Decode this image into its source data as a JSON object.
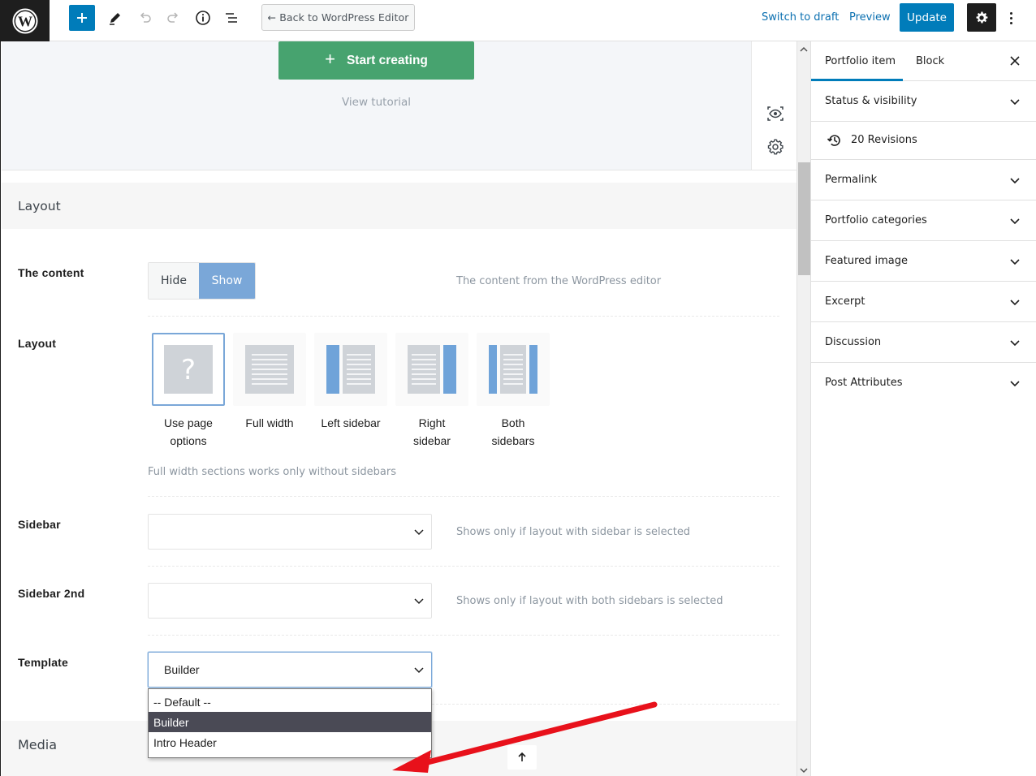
{
  "toolbar": {
    "back_label": "← Back to WordPress Editor",
    "switch_draft": "Switch to draft",
    "preview": "Preview",
    "update": "Update"
  },
  "builder": {
    "start_label": "Start creating",
    "tutorial_label": "View tutorial"
  },
  "layout_section": {
    "heading": "Layout",
    "content": {
      "label": "The content",
      "options": [
        "Hide",
        "Show"
      ],
      "selected": "Show",
      "hint": "The content from the WordPress editor"
    },
    "layout": {
      "label": "Layout",
      "options": [
        {
          "line1": "Use page",
          "line2": "options"
        },
        {
          "line1": "Full width",
          "line2": ""
        },
        {
          "line1": "Left sidebar",
          "line2": ""
        },
        {
          "line1": "Right",
          "line2": "sidebar"
        },
        {
          "line1": "Both",
          "line2": "sidebars"
        }
      ],
      "selected": "Use page options",
      "hint": "Full width sections works only without sidebars"
    },
    "sidebar": {
      "label": "Sidebar",
      "value": "",
      "hint": "Shows only if layout with sidebar is selected"
    },
    "sidebar2": {
      "label": "Sidebar 2nd",
      "value": "",
      "hint": "Shows only if layout with both sidebars is selected"
    },
    "template": {
      "label": "Template",
      "value": "Builder",
      "options": [
        "-- Default --",
        "Builder",
        "Intro Header"
      ],
      "highlighted": "Builder"
    }
  },
  "media_section": {
    "heading": "Media"
  },
  "sidebar": {
    "tabs": [
      "Portfolio item",
      "Block"
    ],
    "active_tab": "Portfolio item",
    "revisions": "20 Revisions",
    "panels": [
      "Status & visibility",
      "Permalink",
      "Portfolio categories",
      "Featured image",
      "Excerpt",
      "Discussion",
      "Post Attributes"
    ]
  },
  "colors": {
    "accent": "#007cba",
    "start_button": "#47a36f",
    "toggle_on": "#7aa7d8",
    "annotation_arrow": "#e8111b"
  }
}
